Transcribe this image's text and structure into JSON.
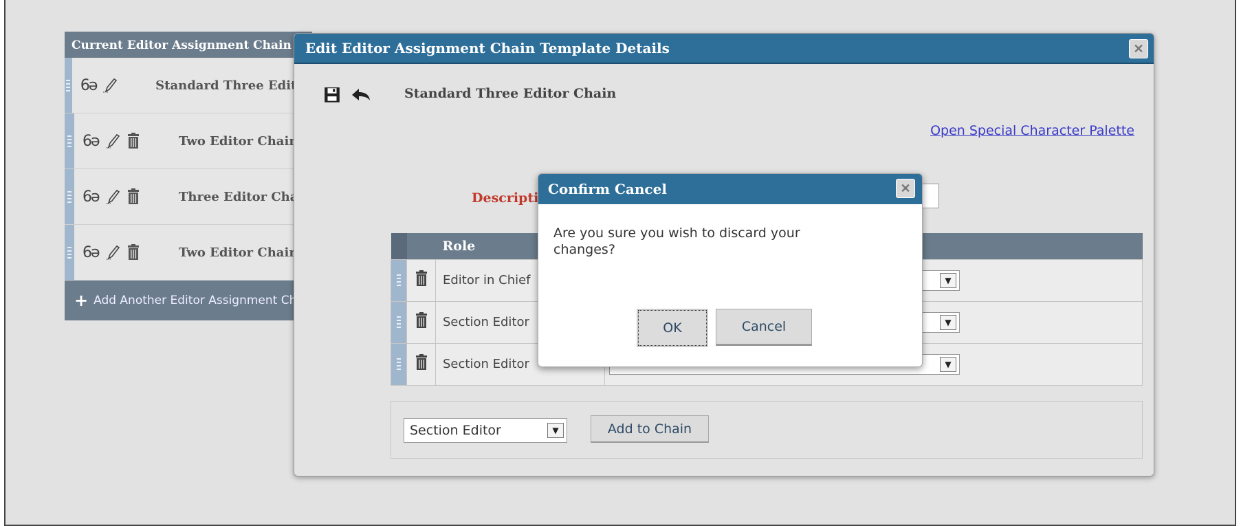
{
  "chain_list": {
    "header": "Current Editor Assignment Chain Templates",
    "rows": [
      {
        "name": "Standard Three Editor Chain",
        "has_delete": false
      },
      {
        "name": "Two Editor Chain",
        "has_delete": true
      },
      {
        "name": "Three Editor Chain",
        "has_delete": true
      },
      {
        "name": "Two Editor Chain",
        "has_delete": true
      }
    ],
    "add_label": "Add Another Editor Assignment Chain Template"
  },
  "main_modal": {
    "title": "Edit Editor Assignment Chain Template Details",
    "chain_name": "Standard Three Editor Chain",
    "palette_link": "Open Special Character Palette",
    "description_label": "Description:",
    "table": {
      "role_header": "Role",
      "rows": [
        {
          "role": "Editor in Chief"
        },
        {
          "role": "Section Editor"
        },
        {
          "role": "Section Editor"
        }
      ]
    },
    "role_select_value": "Section Editor",
    "add_button": "Add to Chain"
  },
  "confirm_dialog": {
    "title": "Confirm Cancel",
    "message": "Are you sure you wish to discard your changes?",
    "ok_label": "OK",
    "cancel_label": "Cancel"
  },
  "icons": {
    "view": "glasses-icon",
    "edit": "pencil-icon",
    "delete": "trash-icon",
    "save": "save-icon",
    "back": "back-arrow-icon",
    "close": "close-icon",
    "add": "plus-icon",
    "dropdown": "chevron-down-icon"
  },
  "colors": {
    "title_bar": "#2e6f99",
    "table_header": "#6b7c8c",
    "drag_handle": "#9fb6cc",
    "required_label": "#c0392b",
    "link": "#3a3ac8"
  }
}
